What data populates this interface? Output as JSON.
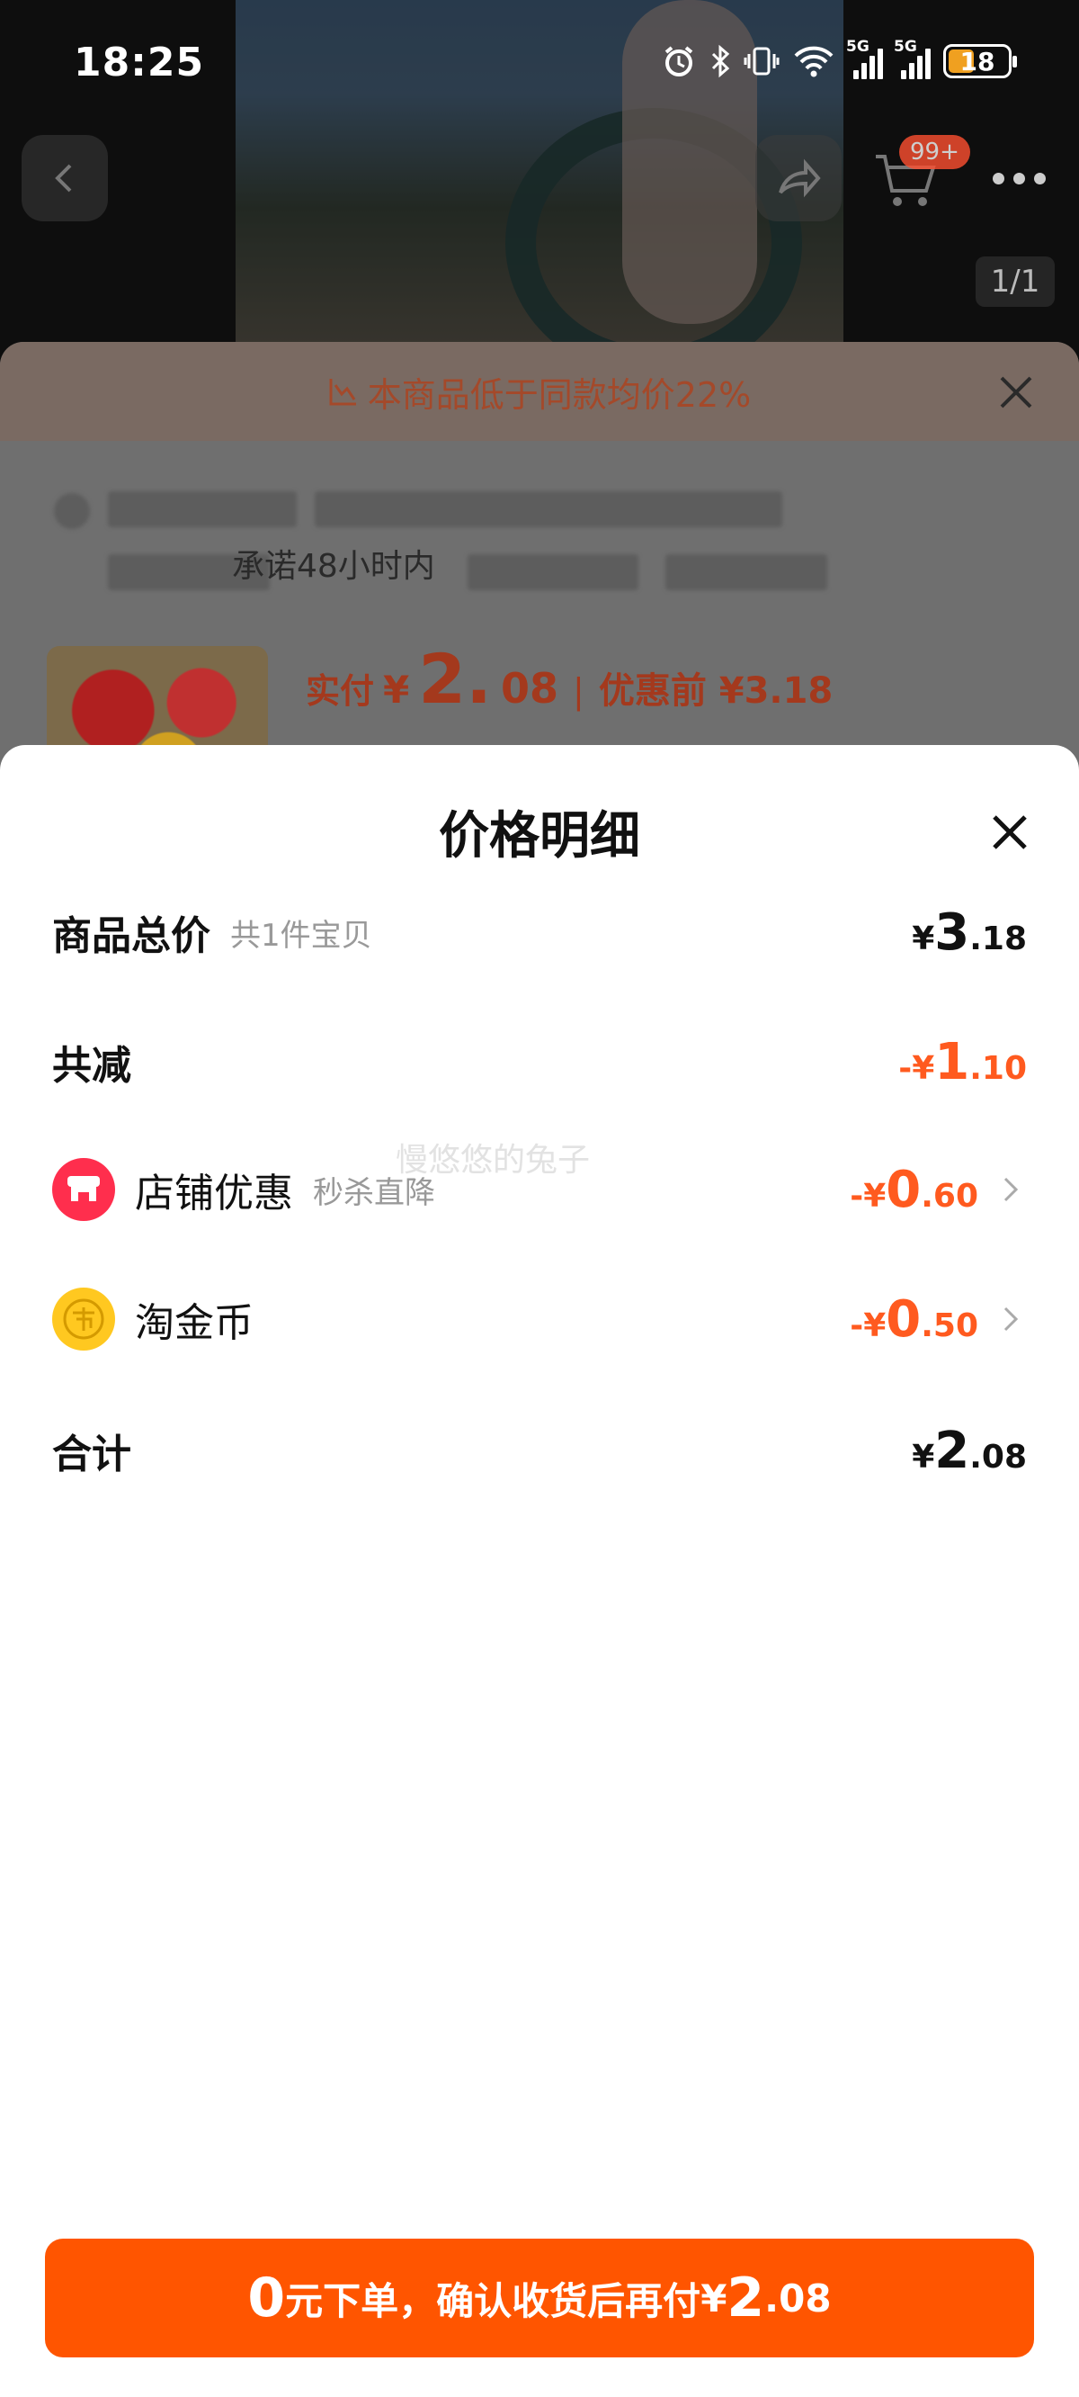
{
  "status_bar": {
    "time": "18:25",
    "battery": "18",
    "net1": "5G",
    "net2": "5G"
  },
  "nav": {
    "cart_badge": "99+",
    "image_counter": "1/1"
  },
  "background": {
    "banner_text": "本商品低于同款均价22%",
    "promise_text": "承诺48小时内",
    "real_pay_label": "实付",
    "real_pay_yen": "¥",
    "real_pay_int": "2.",
    "real_pay_dec": "08",
    "separator": "|",
    "before_text": "优惠前 ¥3.18"
  },
  "sheet": {
    "title": "价格明细",
    "watermark": "慢悠悠的兔子",
    "rows": [
      {
        "label": "商品总价",
        "sub": "共1件宝贝",
        "sym": "¥",
        "int": "3",
        "dec": ".18"
      },
      {
        "label": "共减",
        "sym": "-¥",
        "int": "1",
        "dec": ".10"
      },
      {
        "label": "店铺优惠",
        "sub": "秒杀直降",
        "sym": "-¥",
        "int": "0",
        "dec": ".60"
      },
      {
        "label": "淘金币",
        "sym": "-¥",
        "int": "0",
        "dec": ".50"
      },
      {
        "label": "合计",
        "sym": "¥",
        "int": "2",
        "dec": ".08"
      }
    ]
  },
  "cta": {
    "zero": "0",
    "text": "元下单，确认收货后再付",
    "yen": "¥",
    "int": "2",
    "dec": ".08"
  },
  "colors": {
    "accent": "#ff5500",
    "discount": "#ff5a1f",
    "shop_icon": "#ff2e4d",
    "coin_icon": "#ffc820"
  }
}
